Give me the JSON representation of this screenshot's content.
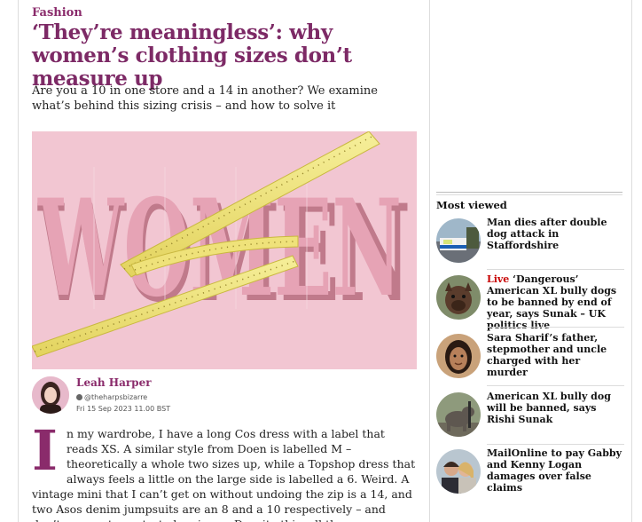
{
  "article": {
    "section": "Fashion",
    "headline": "‘They’re meaningless’: why women’s clothing sizes don’t measure up",
    "standfirst": "Are you a 10 in one store and a 14 in another? We examine what’s behind this sizing crisis – and how to solve it",
    "hero_image": {
      "visible_word": "WOMEN"
    },
    "byline": {
      "author": "Leah Harper",
      "handle": "@theharpsbizarre",
      "date": "Fri 15 Sep 2023 11.00 BST"
    },
    "dropcap": "I",
    "body": "n my wardrobe, I have a long Cos dress with a label that reads XS. A similar style from Doen is labelled M – theoretically a whole two sizes up, while a Topshop dress that always feels a little on the large side is labelled a 6. Weird. A vintage mini that I can’t get on without undoing the zip is a 14, and two Asos denim jumpsuits are an 8 and a 10 respectively – and don’t even get me started on jeans. Despite this, all these"
  },
  "most_viewed": {
    "title": "Most viewed",
    "items": [
      {
        "live": "",
        "text": "Man dies after double dog attack in Staffordshire"
      },
      {
        "live": "Live",
        "text": " ‘Dangerous’ American XL bully dogs to be banned by end of year, says Sunak – UK politics live"
      },
      {
        "live": "",
        "text": "Sara Sharif’s father, stepmother and uncle charged with her murder"
      },
      {
        "live": "",
        "text": "American XL bully dog will be banned, says Rishi Sunak"
      },
      {
        "live": "",
        "text": "MailOnline to pay Gabby and Kenny Logan damages over false claims"
      }
    ]
  },
  "colors": {
    "fashion_accent": "#8a2b6b",
    "live_red": "#c70000",
    "hero_background": "#f2c6d2"
  }
}
